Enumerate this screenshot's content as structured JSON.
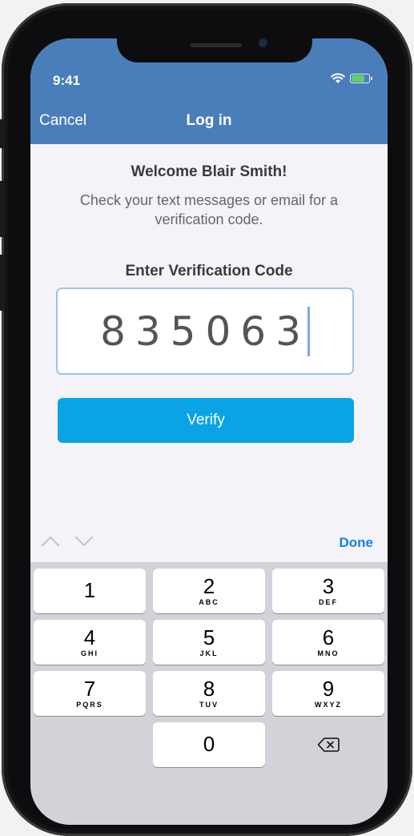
{
  "status": {
    "time": "9:41",
    "wifi_icon": "wifi-icon",
    "battery_icon": "battery-charging-icon"
  },
  "nav": {
    "cancel_label": "Cancel",
    "title": "Log in"
  },
  "content": {
    "welcome": "Welcome Blair Smith!",
    "instructions": "Check your text messages or email for a verification code.",
    "code_label": "Enter Verification Code",
    "code_value": "835063",
    "verify_label": "Verify"
  },
  "keyboard": {
    "done_label": "Done",
    "keys": [
      {
        "num": "1",
        "letters": ""
      },
      {
        "num": "2",
        "letters": "ABC"
      },
      {
        "num": "3",
        "letters": "DEF"
      },
      {
        "num": "4",
        "letters": "GHI"
      },
      {
        "num": "5",
        "letters": "JKL"
      },
      {
        "num": "6",
        "letters": "MNO"
      },
      {
        "num": "7",
        "letters": "PQRS"
      },
      {
        "num": "8",
        "letters": "TUV"
      },
      {
        "num": "9",
        "letters": "WXYZ"
      },
      {
        "num": "0",
        "letters": ""
      }
    ]
  },
  "colors": {
    "header": "#4a7ebb",
    "verify_button": "#0aa3e6",
    "done": "#1a7fe0",
    "keypad_bg": "#d1d3d9"
  }
}
